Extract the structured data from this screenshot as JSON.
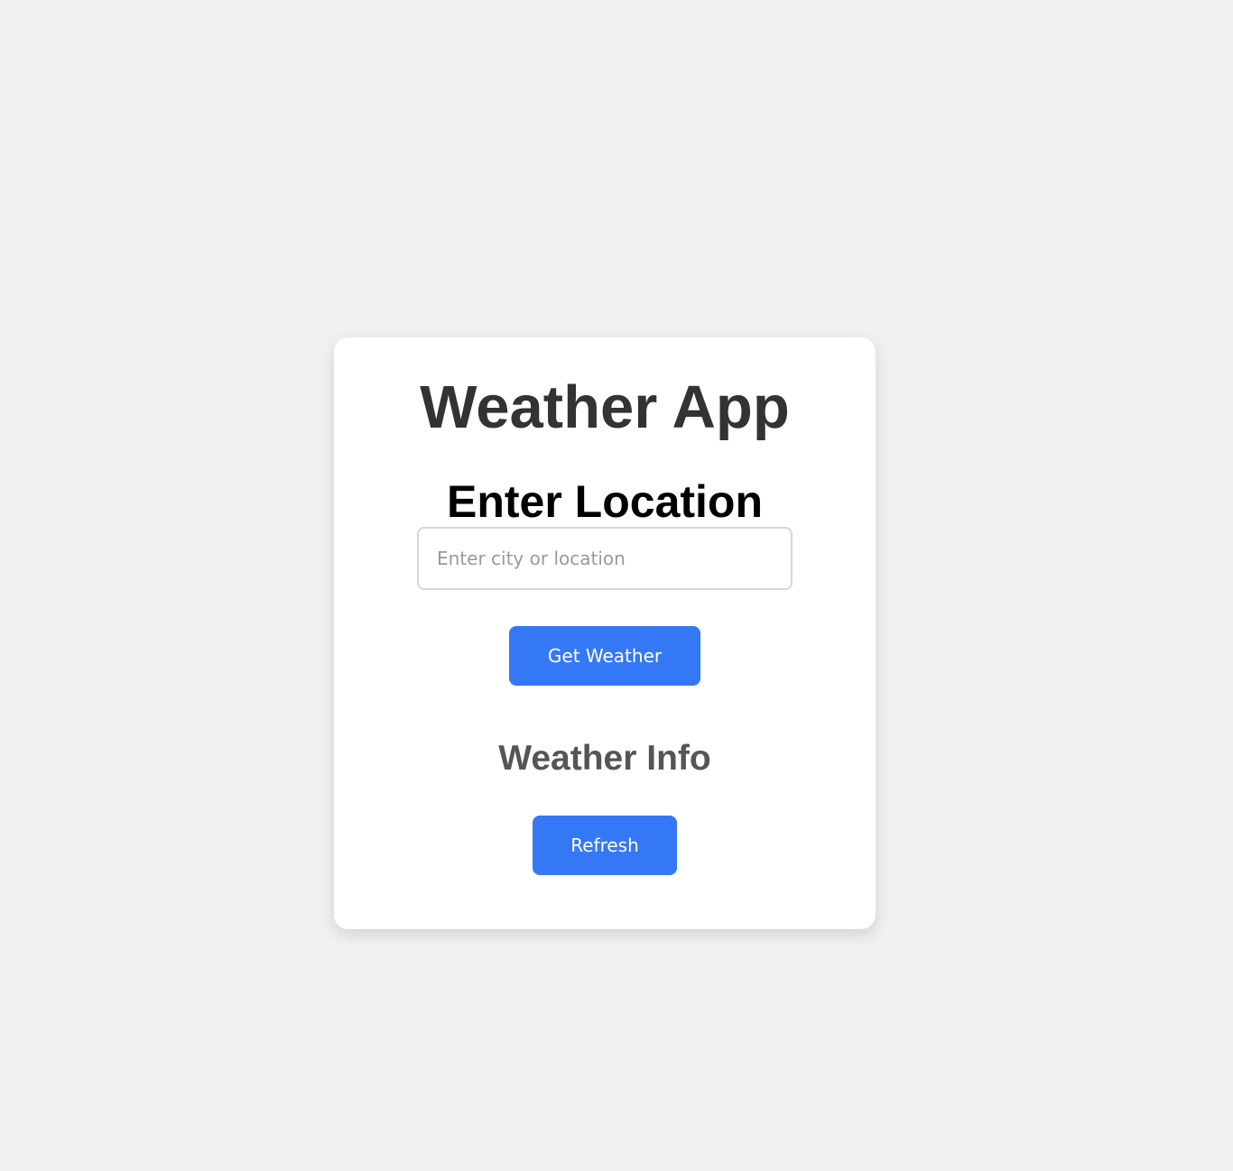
{
  "app": {
    "title": "Weather App"
  },
  "location": {
    "heading": "Enter Location",
    "input_value": "",
    "input_placeholder": "Enter city or location",
    "submit_label": "Get Weather"
  },
  "weather_info": {
    "heading": "Weather Info",
    "refresh_label": "Refresh"
  },
  "colors": {
    "background": "#f0f0f0",
    "card": "#ffffff",
    "accent": "#3478f6",
    "title_text": "#333333",
    "info_heading": "#555555"
  }
}
